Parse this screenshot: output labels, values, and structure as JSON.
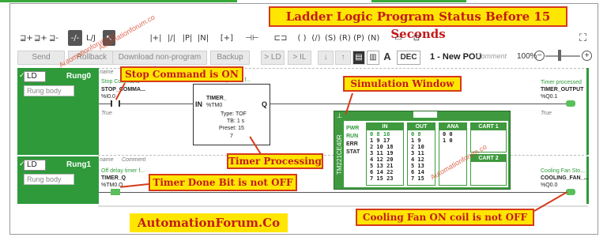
{
  "title_banner": "Ladder Logic Program Status Before 15 Seconds",
  "toolbar1": {
    "items": [
      "⊒+",
      "⊒+",
      "⊒-",
      "-/-",
      "L/J",
      "↖",
      "|+|",
      "|/|",
      "|P|",
      "|N|",
      "-( )-",
      "-(/)-",
      "-(S)-",
      "-(R)-",
      "[+]",
      "⊣⊢",
      "⊏⊐",
      "( )",
      "(/)",
      "(S)",
      "(R)",
      "(P)",
      "(N)",
      "▭",
      "⊡"
    ]
  },
  "toolbar2": {
    "send": "Send",
    "rollback": "Rollback",
    "download": "Download non-program data",
    "backup": "Backup",
    "to_ld": "> LD",
    "to_il": "> IL",
    "dec": "DEC",
    "pou": "1 - New POU",
    "comment": "Comment",
    "zoom": "100%"
  },
  "rung0": {
    "lang": "LD",
    "name": "Rung0",
    "body": "Rung body",
    "contact_comment": "Stop Command",
    "contact_symbol": "STOP_COMMA...",
    "contact_addr": "%I0.0",
    "contact_value": "True",
    "timer_comment": "Off delay timer f...",
    "timer_in": "IN",
    "timer_q": "Q",
    "timer_name": "TIMER_",
    "timer_addr": "%TM0",
    "timer_type": "Type: TOF",
    "timer_tb": "TB: 1 s",
    "timer_preset": "Preset: 15",
    "timer_value": "7",
    "coil_comment": "Timer processed",
    "coil_symbol": "TIMER_OUTPUT",
    "coil_addr": "%Q0.1",
    "coil_value": "True",
    "name_label": "name"
  },
  "rung1": {
    "lang": "LD",
    "name": "Rung1",
    "body": "Rung body",
    "name_label": "name",
    "comment_label": "Comment",
    "contact_comment": "Off delay timer f...",
    "contact_symbol": "TIMER_Q",
    "contact_addr": "%TM0.Q",
    "coil_comment": "Cooling Fan Sto...",
    "coil_symbol": "COOLING_FAN_...",
    "coil_addr": "%Q0.0"
  },
  "sim": {
    "model": "TM221CE40R",
    "status_labels": [
      "PWR",
      "RUN",
      "ERR",
      "STAT"
    ],
    "in_head": "IN",
    "out_head": "OUT",
    "ana_head": "ANA",
    "cart1": "CART 1",
    "cart2": "CART 2",
    "in_rows": [
      "0  8  16",
      "1  9  17",
      "2  10  18",
      "3  11  19",
      "4  12  20",
      "5  13  21",
      "6  14  22",
      "7  15  23"
    ],
    "out_rows": [
      "0  8",
      "1  9",
      "2  10",
      "3  11",
      "4  12",
      "5  13",
      "6  14",
      "7  15"
    ],
    "ana_rows": [
      "0  0",
      "1  0"
    ]
  },
  "callouts": {
    "stop": "Stop Command is ON",
    "sim": "Simulation Window",
    "timer": "Timer Processing",
    "done": "Timer Done Bit is not OFF",
    "fan": "Cooling Fan ON coil is not OFF"
  },
  "watermarks": [
    "Automationforum.co",
    "Automationforum.co",
    "Automationforum.co"
  ],
  "brand": "AutomationForum.Co",
  "colors": {
    "accent_green": "#2e9a3a",
    "callout_yellow": "#ffe600",
    "callout_red": "#d63a1a"
  }
}
